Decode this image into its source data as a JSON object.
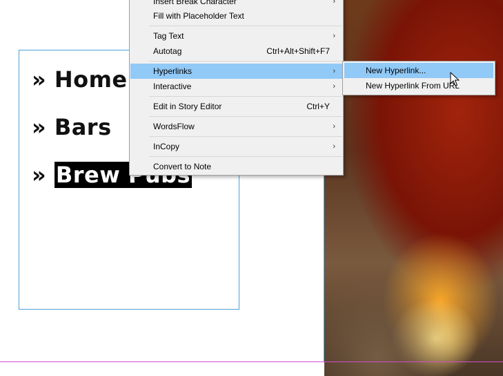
{
  "page": {
    "nav_items": [
      {
        "prefix": "» ",
        "label": "Home"
      },
      {
        "prefix": "» ",
        "label": "Bars"
      },
      {
        "prefix": "» ",
        "label": "Brew Pubs"
      }
    ]
  },
  "context_menu": {
    "items": [
      {
        "label": "Insert Break Character",
        "shortcut": "",
        "submenu": true
      },
      {
        "label": "Fill with Placeholder Text",
        "shortcut": "",
        "submenu": false
      },
      {
        "label": "Tag Text",
        "shortcut": "",
        "submenu": true
      },
      {
        "label": "Autotag",
        "shortcut": "Ctrl+Alt+Shift+F7",
        "submenu": false
      },
      {
        "label": "Hyperlinks",
        "shortcut": "",
        "submenu": true,
        "highlighted": true
      },
      {
        "label": "Interactive",
        "shortcut": "",
        "submenu": true
      },
      {
        "label": "Edit in Story Editor",
        "shortcut": "Ctrl+Y",
        "submenu": false
      },
      {
        "label": "WordsFlow",
        "shortcut": "",
        "submenu": true
      },
      {
        "label": "InCopy",
        "shortcut": "",
        "submenu": true
      },
      {
        "label": "Convert to Note",
        "shortcut": "",
        "submenu": false
      }
    ],
    "submenu_arrow": "›"
  },
  "submenu": {
    "items": [
      {
        "label": "New Hyperlink...",
        "highlighted": true
      },
      {
        "label": "New Hyperlink From URL",
        "highlighted": false
      }
    ]
  },
  "colors": {
    "highlight": "#91c9f7",
    "frame": "#4ba0d4",
    "guide": "#d44cd0"
  },
  "icons": {
    "cursor": "arrow-pointer-icon",
    "submenu": "chevron-right-icon"
  }
}
